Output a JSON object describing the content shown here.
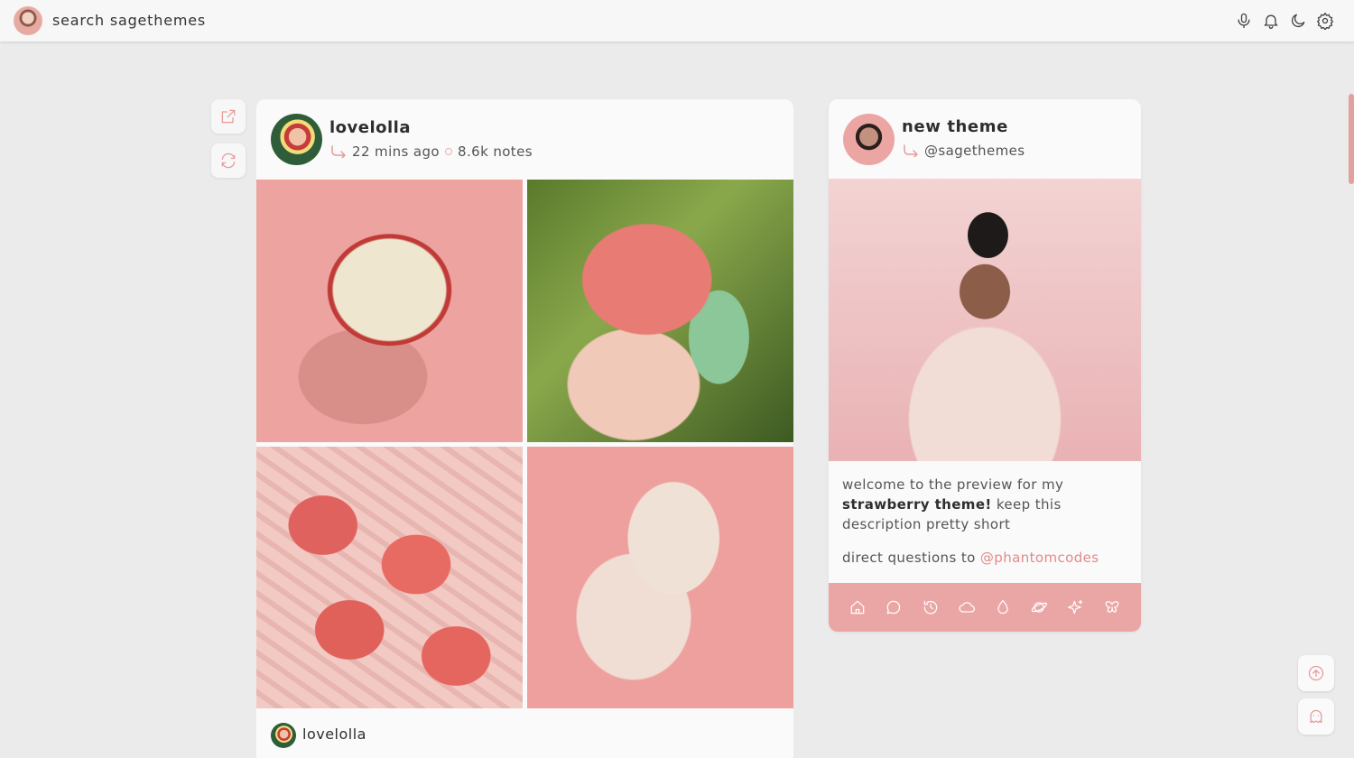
{
  "topbar": {
    "search_text": "search sagethemes",
    "icons": [
      "microphone-icon",
      "bell-icon",
      "moon-icon",
      "gear-icon"
    ]
  },
  "side_actions": [
    "external-link-icon",
    "refresh-icon"
  ],
  "post": {
    "username": "lovelolla",
    "time": "22 mins ago",
    "notes": "8.6k notes",
    "footer_username": "lovelolla"
  },
  "card": {
    "title": "new theme",
    "handle": "@sagethemes",
    "desc_prefix": "welcome to the preview for my",
    "desc_bold": "strawberry theme!",
    "desc_suffix": "keep this description pretty short",
    "contact_prefix": "direct questions to",
    "contact_link": "@phantomcodes",
    "nav_icons": [
      "home-icon",
      "chat-icon",
      "history-icon",
      "cloud-icon",
      "drop-icon",
      "planet-icon",
      "sparkle-icon",
      "butterfly-icon"
    ]
  },
  "floating": [
    "scroll-top-icon",
    "ghost-icon"
  ],
  "colors": {
    "accent": "#e69a99",
    "nav_bg": "#eaa6a5",
    "page_bg": "#ebebeb"
  }
}
